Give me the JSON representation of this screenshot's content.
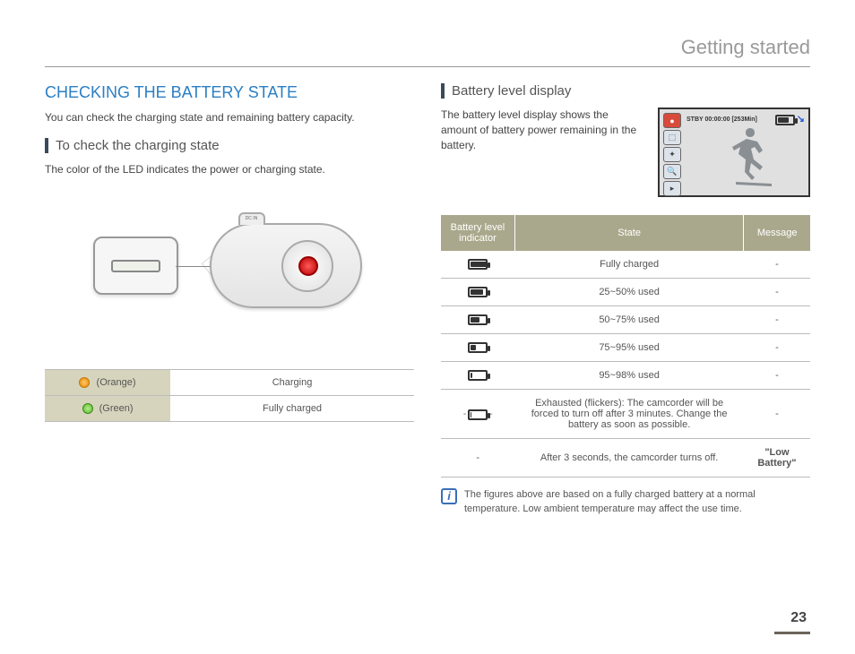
{
  "page": {
    "section_title": "Getting started",
    "number": "23"
  },
  "left": {
    "heading": "CHECKING THE BATTERY STATE",
    "intro": "You can check the charging state and remaining battery capacity.",
    "sub1": "To check the charging state",
    "sub1_body": "The color of the LED indicates the power or charging state.",
    "port_label": "DC IN",
    "led_table": [
      {
        "color_label": "(Orange)",
        "state": "Charging"
      },
      {
        "color_label": "(Green)",
        "state": "Fully charged"
      }
    ]
  },
  "right": {
    "sub1": "Battery level display",
    "sub1_body": "The battery level display shows the amount of battery power remaining in the battery.",
    "screen": {
      "status": "STBY 00:00:00 [253Min]"
    },
    "table": {
      "headers": {
        "indicator": "Battery level indicator",
        "state": "State",
        "message": "Message"
      },
      "rows": [
        {
          "fill": 100,
          "state": "Fully charged",
          "message": "-"
        },
        {
          "fill": 75,
          "state": "25~50% used",
          "message": "-"
        },
        {
          "fill": 55,
          "state": "50~75% used",
          "message": "-"
        },
        {
          "fill": 30,
          "state": "75~95% used",
          "message": "-"
        },
        {
          "fill": 12,
          "state": "95~98% used",
          "message": "-"
        },
        {
          "fill": 5,
          "flicker": true,
          "state": "Exhausted (flickers): The camcorder will be forced to turn off after 3 minutes. Change the battery as soon as possible.",
          "message": "-"
        },
        {
          "none": true,
          "state": "After 3 seconds, the camcorder turns off.",
          "message": "\"Low Battery\""
        }
      ]
    },
    "note": "The figures above are based on a fully charged battery at a normal temperature. Low ambient temperature may affect the use time."
  }
}
